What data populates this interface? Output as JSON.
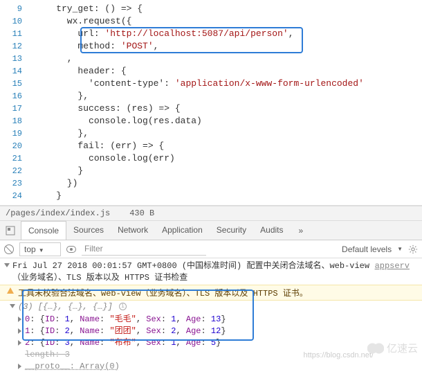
{
  "code": {
    "lines": [
      {
        "n": 9,
        "indent": 2,
        "t": "try_get: () => {"
      },
      {
        "n": 10,
        "indent": 3,
        "t": "wx.request({"
      },
      {
        "n": 11,
        "indent": 4,
        "key": "url",
        "val": "'http://localhost:5087/api/person'",
        "tail": ","
      },
      {
        "n": 12,
        "indent": 4,
        "key": "method",
        "val": "'POST'",
        "tail": ","
      },
      {
        "n": 13,
        "indent": 3,
        "t": ","
      },
      {
        "n": 14,
        "indent": 4,
        "t": "header: {"
      },
      {
        "n": 15,
        "indent": 5,
        "key": "'content-type'",
        "val": "'application/x-www-form-urlencoded'"
      },
      {
        "n": 16,
        "indent": 4,
        "t": "},"
      },
      {
        "n": 17,
        "indent": 4,
        "t": "success: (res) => {"
      },
      {
        "n": 18,
        "indent": 5,
        "t": "console.log(res.data)"
      },
      {
        "n": 19,
        "indent": 4,
        "t": "},"
      },
      {
        "n": 20,
        "indent": 4,
        "t": "fail: (err) => {"
      },
      {
        "n": 21,
        "indent": 5,
        "t": "console.log(err)"
      },
      {
        "n": 22,
        "indent": 4,
        "t": "}"
      },
      {
        "n": 23,
        "indent": 3,
        "t": "})"
      },
      {
        "n": 24,
        "indent": 2,
        "t": "}"
      }
    ]
  },
  "filebar": {
    "path": "/pages/index/index.js",
    "size": "430 B"
  },
  "devtools": {
    "tabs": [
      "Console",
      "Sources",
      "Network",
      "Application",
      "Security",
      "Audits"
    ],
    "active": 0,
    "more": "»"
  },
  "toolbar": {
    "context": "top",
    "filter_placeholder": "Filter",
    "levels": "Default levels"
  },
  "console": {
    "timestamp": "Fri Jul 27 2018 00:01:57 GMT+0800 (中国标准时间) 配置中关闭合法域名、web-view（业务域名）、TLS 版本以及 HTTPS 证书检查",
    "source_link": "appserv",
    "warning": "工具未校验合法域名、web-view（业务域名）、TLS 版本以及 HTTPS 证书。",
    "array_preview": "(3) [{…}, {…}, {…}]",
    "items": [
      {
        "idx": "0",
        "ID": 1,
        "Name": "\"毛毛\"",
        "Sex": 1,
        "Age": 13
      },
      {
        "idx": "1",
        "ID": 2,
        "Name": "\"团团\"",
        "Sex": 2,
        "Age": 12
      },
      {
        "idx": "2",
        "ID": 3,
        "Name": "\"布布\"",
        "Sex": 1,
        "Age": 5
      }
    ],
    "length_label": "length: 3",
    "proto_label": "__proto__: Array(0)"
  },
  "watermarks": {
    "w1": "https://blog.csdn.net/",
    "w2": "亿速云"
  }
}
